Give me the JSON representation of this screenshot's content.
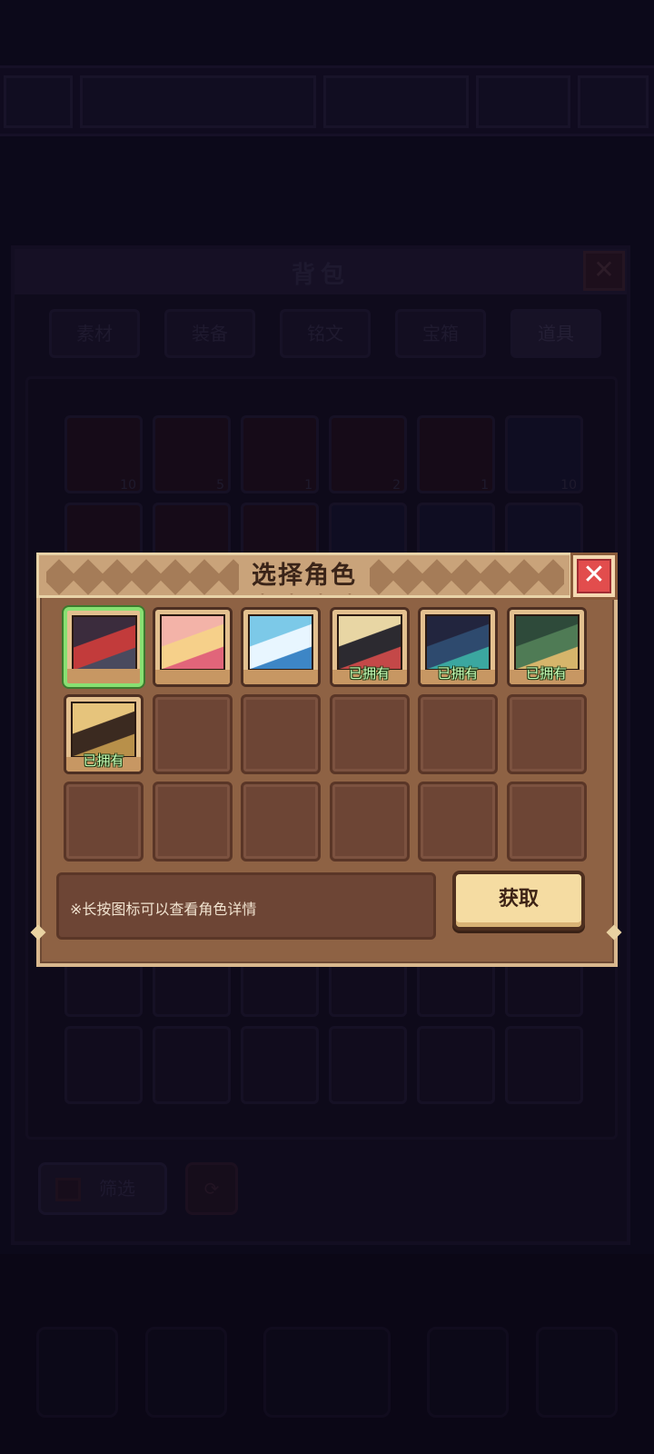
{
  "background": {
    "bag_title": "背包",
    "bag_close": "✕",
    "tabs": [
      "素材",
      "装备",
      "铭文",
      "宝箱",
      "道具"
    ],
    "active_tab_index": 4,
    "items": [
      {
        "kind": "red",
        "count": "10"
      },
      {
        "kind": "red",
        "count": "5"
      },
      {
        "kind": "red",
        "count": "1"
      },
      {
        "kind": "red",
        "count": "2"
      },
      {
        "kind": "red",
        "count": "1"
      },
      {
        "kind": "blue",
        "count": "10"
      }
    ],
    "filter_label": "筛选"
  },
  "dialog": {
    "title": "选择角色",
    "close_label": "✕",
    "owned_label": "已拥有",
    "hint": "※长按图标可以查看角色详情",
    "get_button": "获取",
    "characters": [
      {
        "id": "char-1",
        "owned": false,
        "selected": true,
        "colors": [
          "#3b2c3d",
          "#c23b3b",
          "#4a4a5e"
        ]
      },
      {
        "id": "char-2",
        "owned": false,
        "selected": false,
        "colors": [
          "#f3b3a8",
          "#f6d08a",
          "#e1657a"
        ]
      },
      {
        "id": "char-3",
        "owned": false,
        "selected": false,
        "colors": [
          "#7cc9e8",
          "#e8f6ff",
          "#3d86c6"
        ]
      },
      {
        "id": "char-4",
        "owned": true,
        "selected": false,
        "colors": [
          "#e8d6a4",
          "#2c2a30",
          "#c44848"
        ]
      },
      {
        "id": "char-5",
        "owned": true,
        "selected": false,
        "colors": [
          "#22253e",
          "#2e4a6e",
          "#3ba7a0"
        ]
      },
      {
        "id": "char-6",
        "owned": true,
        "selected": false,
        "colors": [
          "#2e4a3a",
          "#4f7b55",
          "#d6b56b"
        ]
      },
      {
        "id": "char-7",
        "owned": true,
        "selected": false,
        "colors": [
          "#e6c47c",
          "#3b2a20",
          "#b8904a"
        ]
      }
    ],
    "total_slots": 18
  }
}
